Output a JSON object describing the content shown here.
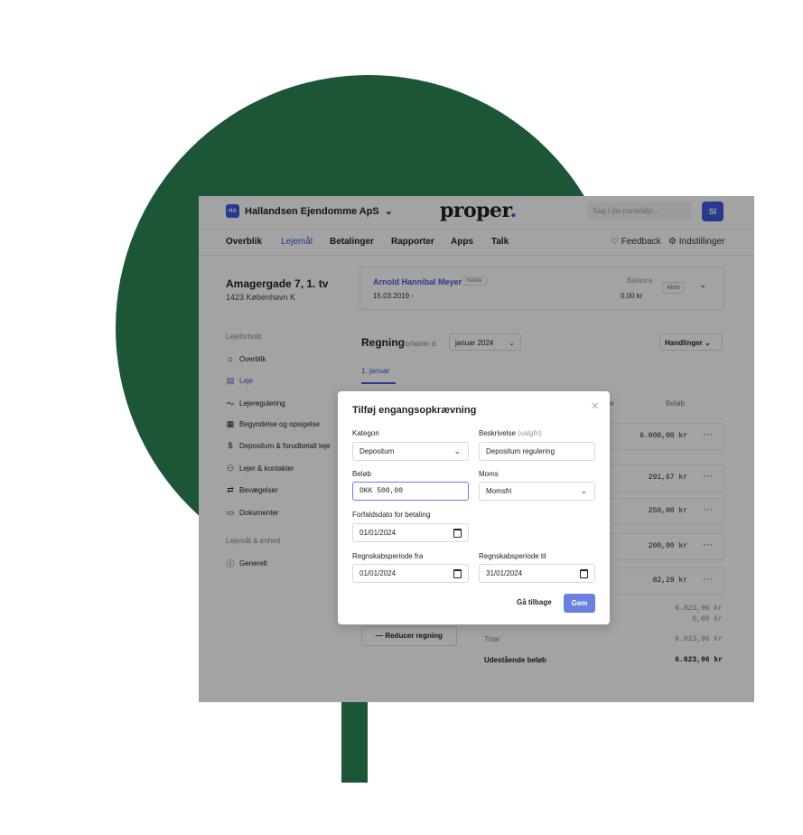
{
  "header": {
    "company_badge": "HA",
    "company_name": "Hallandsen Ejendomme ApS",
    "logo_text": "proper",
    "logo_dot": ".",
    "search_placeholder": "Søg i din portefølje...",
    "avatar_initials": "SI"
  },
  "nav": {
    "items": [
      "Overblik",
      "Lejemål",
      "Betalinger",
      "Rapporter",
      "Apps",
      "Talk"
    ],
    "feedback": "Feedback",
    "settings": "Indstillinger"
  },
  "property": {
    "address": "Amagergade 7, 1. tv",
    "city": "1423 København K"
  },
  "tenant": {
    "name": "Arnold Hannibal Meyer",
    "tag": "mobile",
    "date": "15.03.2019 -",
    "balance_label": "Balance",
    "balance_value": "0,00 kr",
    "status": "Aktiv"
  },
  "sidebar": {
    "heading1": "Lejeforhold",
    "items": [
      {
        "label": "Overblik",
        "icon": "home-icon"
      },
      {
        "label": "Leje",
        "icon": "receipt-icon"
      },
      {
        "label": "Lejeregulering",
        "icon": "trend-icon"
      },
      {
        "label": "Begyndelse og opsigelse",
        "icon": "calendar-icon"
      },
      {
        "label": "Depositum & forudbetalt leje",
        "icon": "dollar-icon"
      },
      {
        "label": "Lejer & kontakter",
        "icon": "users-icon"
      },
      {
        "label": "Bevægelser",
        "icon": "transfer-icon"
      },
      {
        "label": "Dokumenter",
        "icon": "folder-icon"
      }
    ],
    "heading2": "Lejemål & enhed",
    "items2": [
      {
        "label": "Generelt",
        "icon": "info-icon"
      }
    ]
  },
  "regning": {
    "title": "Regning",
    "subtitle": "forfalder d.",
    "month": "januar 2024",
    "actions": "Handlinger",
    "tab": "1. januar",
    "col_partial": "e",
    "col_amount": "Beløb",
    "lines": [
      "6.000,00 kr",
      "291,67 kr",
      "250,00 kr",
      "200,00 kr",
      "82,29 kr"
    ],
    "subtotal1": "6.823,96 kr",
    "subtotal2": "0,00 kr",
    "total_label": "Total",
    "total_value": "6.823,96 kr",
    "due_label": "Udestående beløb",
    "due_value": "6.823,96 kr",
    "reduce_button": "Reducer regning"
  },
  "modal": {
    "title": "Tilføj engangsopkrævning",
    "kategori_label": "Kategori",
    "kategori_value": "Depositum",
    "beskrivelse_label": "Beskrivelse",
    "beskrivelse_optional": "(valgfri)",
    "beskrivelse_value": "Depositum regulering",
    "belob_label": "Beløb",
    "belob_value": "DKK  500,00",
    "moms_label": "Moms",
    "moms_value": "Momsfri",
    "forfald_label": "Forfaldsdato for betaling",
    "forfald_value": "01/01/2024",
    "periode_fra_label": "Regnskabsperiode fra",
    "periode_fra_value": "01/01/2024",
    "periode_til_label": "Regnskabsperiode til",
    "periode_til_value": "31/01/2024",
    "back_button": "Gå tilbage",
    "save_button": "Gem"
  },
  "colors": {
    "brand_green": "#1c5636",
    "accent_blue": "#3d5bd9",
    "button_blue": "#6a7fe0"
  }
}
